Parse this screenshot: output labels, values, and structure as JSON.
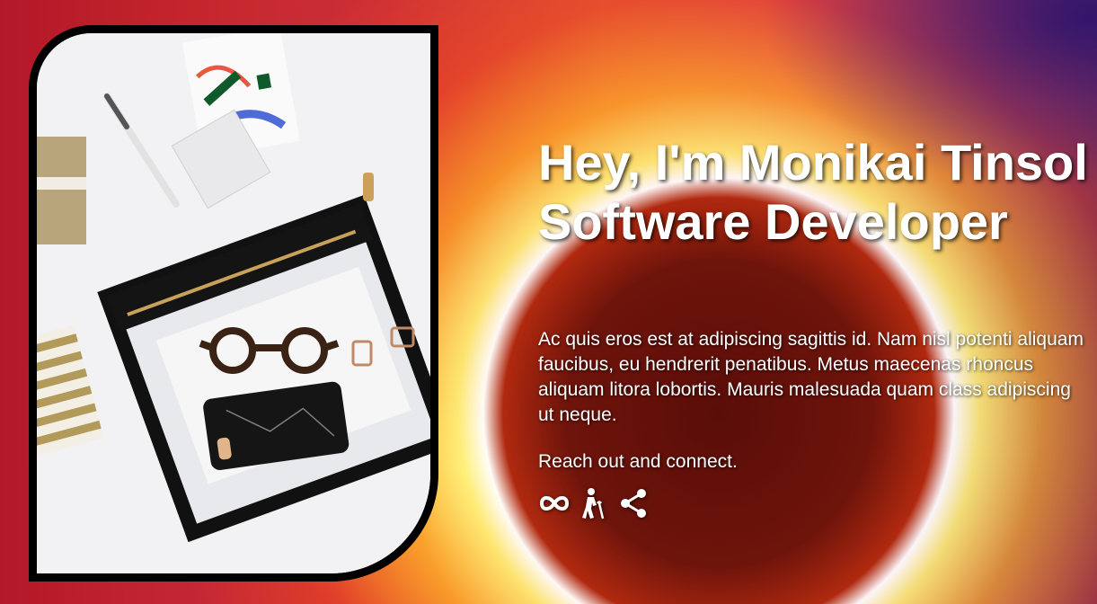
{
  "hero": {
    "title_line1": "Hey, I'm Monikai Tinsol",
    "title_line2": "Software Developer",
    "bio": "Ac quis eros est at adipiscing sagittis id. Nam nisl potenti aliquam faucibus, eu hendrerit penatibus. Metus maecenas rhoncus aliquam litora lobortis. Mauris malesuada quam class adipiscing ut neque.",
    "cta": "Reach out and connect."
  },
  "social": [
    {
      "icon": "infinity-icon"
    },
    {
      "icon": "person-with-cane-icon"
    },
    {
      "icon": "share-icon"
    }
  ],
  "colors": {
    "text": "#ffffff",
    "frame": "#000000"
  }
}
